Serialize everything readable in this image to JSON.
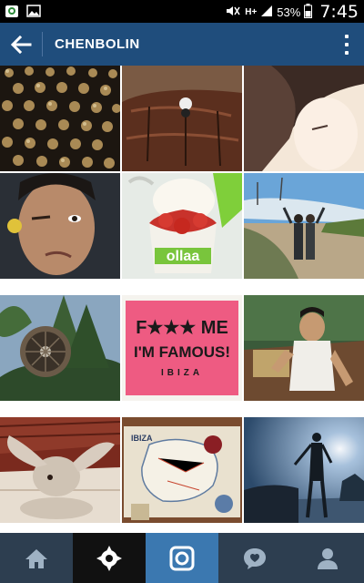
{
  "status_bar": {
    "battery": "53%",
    "time": "7:45",
    "network": "H+",
    "icons": [
      "android-icon",
      "image-icon",
      "mute-icon",
      "signal-icon",
      "battery-icon"
    ]
  },
  "app_bar": {
    "title": "CHENBOLIN",
    "back_icon": "arrow-left-icon",
    "menu_icon": "overflow-menu-icon"
  },
  "photos": [
    {
      "name": "photo-studded-leather"
    },
    {
      "name": "photo-leather-couch"
    },
    {
      "name": "photo-anime-girl"
    },
    {
      "name": "photo-selfie-wink"
    },
    {
      "name": "photo-frozen-yogurt",
      "text": "ollaa"
    },
    {
      "name": "photo-couple-road"
    },
    {
      "name": "photo-fan-trees"
    },
    {
      "name": "photo-pink-shirt",
      "text_line1": "F★★★ ME",
      "text_line2": "I'M FAMOUS!",
      "text_line3": "IBIZA"
    },
    {
      "name": "photo-man-tanktop"
    },
    {
      "name": "photo-rabbit"
    },
    {
      "name": "photo-ibiza-map",
      "text": "IBIZA"
    },
    {
      "name": "photo-sunset-silhouette"
    }
  ],
  "tab_bar": {
    "tabs": [
      {
        "name": "home",
        "icon": "home-icon"
      },
      {
        "name": "explore",
        "icon": "explore-icon",
        "active": true
      },
      {
        "name": "camera",
        "icon": "camera-icon"
      },
      {
        "name": "activity",
        "icon": "speech-bubble-icon"
      },
      {
        "name": "profile",
        "icon": "person-icon"
      }
    ]
  },
  "colors": {
    "app_bar": "#1f4d7c",
    "tab_bar": "#2d3e50",
    "camera_tab": "#3b78b0"
  }
}
